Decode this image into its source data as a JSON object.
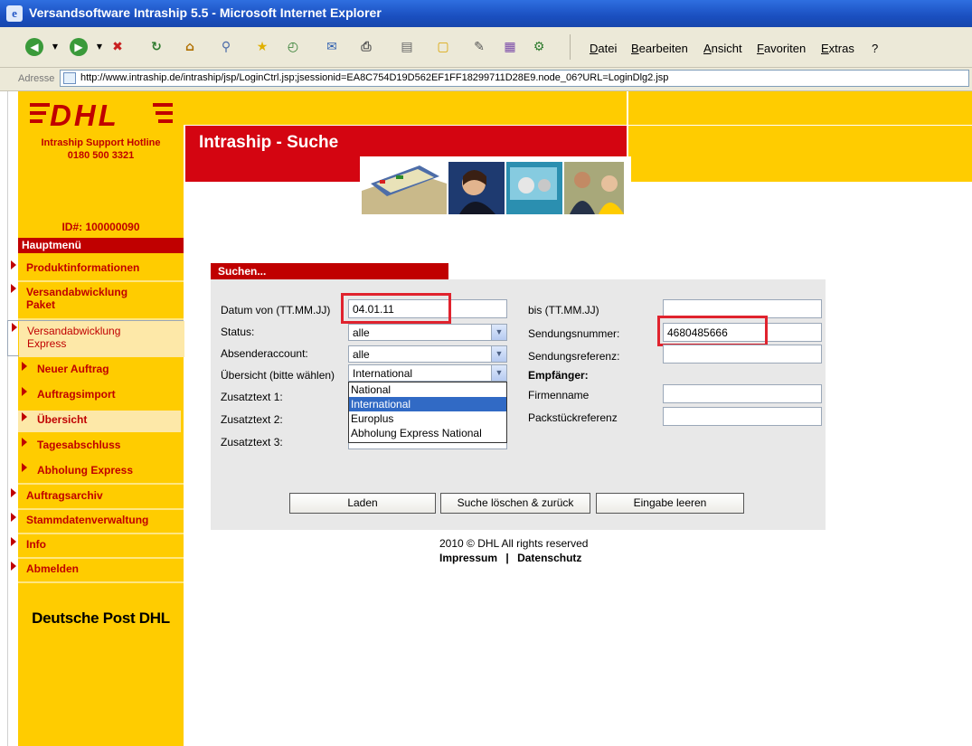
{
  "window": {
    "title": "Versandsoftware Intraship 5.5 - Microsoft Internet Explorer"
  },
  "menubar": [
    "Datei",
    "Bearbeiten",
    "Ansicht",
    "Favoriten",
    "Extras",
    "?"
  ],
  "address": {
    "label": "Adresse",
    "url": "http://www.intraship.de/intraship/jsp/LoginCtrl.jsp;jsessionid=EA8C754D19D562EF1FF18299711D28E9.node_06?URL=LoginDlg2.jsp"
  },
  "brand": {
    "logo": "DHL",
    "hotline_label": "Intraship Support Hotline",
    "hotline_number": "0180 500 3321",
    "footer_logo": "Deutsche Post DHL"
  },
  "banner": {
    "title": "Intraship - Suche"
  },
  "account": {
    "id_label": "ID#: 100000090"
  },
  "nav": {
    "heading": "Hauptmenü",
    "items": [
      {
        "label": "Produktinformationen"
      },
      {
        "label": "Versandabwicklung Paket"
      },
      {
        "label": "Versandabwicklung Express",
        "selected": true
      },
      {
        "label": "Neuer Auftrag",
        "sub": true
      },
      {
        "label": "Auftragsimport",
        "sub": true
      },
      {
        "label": "Übersicht",
        "sub": true,
        "selected": true
      },
      {
        "label": "Tagesabschluss",
        "sub": true
      },
      {
        "label": "Abholung Express",
        "sub": true
      },
      {
        "label": "Auftragsarchiv"
      },
      {
        "label": "Stammdatenverwaltung"
      },
      {
        "label": "Info"
      },
      {
        "label": "Abmelden"
      }
    ]
  },
  "search": {
    "title": "Suchen...",
    "date_from": {
      "label": "Datum von (TT.MM.JJ)",
      "value": "04.01.11"
    },
    "date_to": {
      "label": "bis (TT.MM.JJ)",
      "value": ""
    },
    "status": {
      "label": "Status:",
      "value": "alle"
    },
    "account": {
      "label": "Absenderaccount:",
      "value": "alle"
    },
    "overview": {
      "label": "Übersicht (bitte wählen)",
      "value": "International",
      "options": [
        "National",
        "International",
        "Europlus",
        "Abholung Express National"
      ],
      "highlighted": "International"
    },
    "extra1": {
      "label": "Zusatztext 1:"
    },
    "extra2": {
      "label": "Zusatztext 2:"
    },
    "extra3": {
      "label": "Zusatztext 3:"
    },
    "shipment_number": {
      "label": "Sendungsnummer:",
      "value": "4680485666"
    },
    "shipment_reference": {
      "label": "Sendungsreferenz:",
      "value": ""
    },
    "recipient_heading": "Empfänger:",
    "company": {
      "label": "Firmenname",
      "value": ""
    },
    "package_reference": {
      "label": "Packstückreferenz",
      "value": ""
    },
    "buttons": {
      "load": "Laden",
      "clear_back": "Suche löschen & zurück",
      "reset": "Eingabe leeren"
    }
  },
  "footer": {
    "copyright": "2010 © DHL All rights reserved",
    "impressum": "Impressum",
    "separator": "|",
    "privacy": "Datenschutz"
  },
  "colors": {
    "dhl_yellow": "#ffcc00",
    "dhl_red": "#d40511",
    "highlight": "#e0232e"
  }
}
